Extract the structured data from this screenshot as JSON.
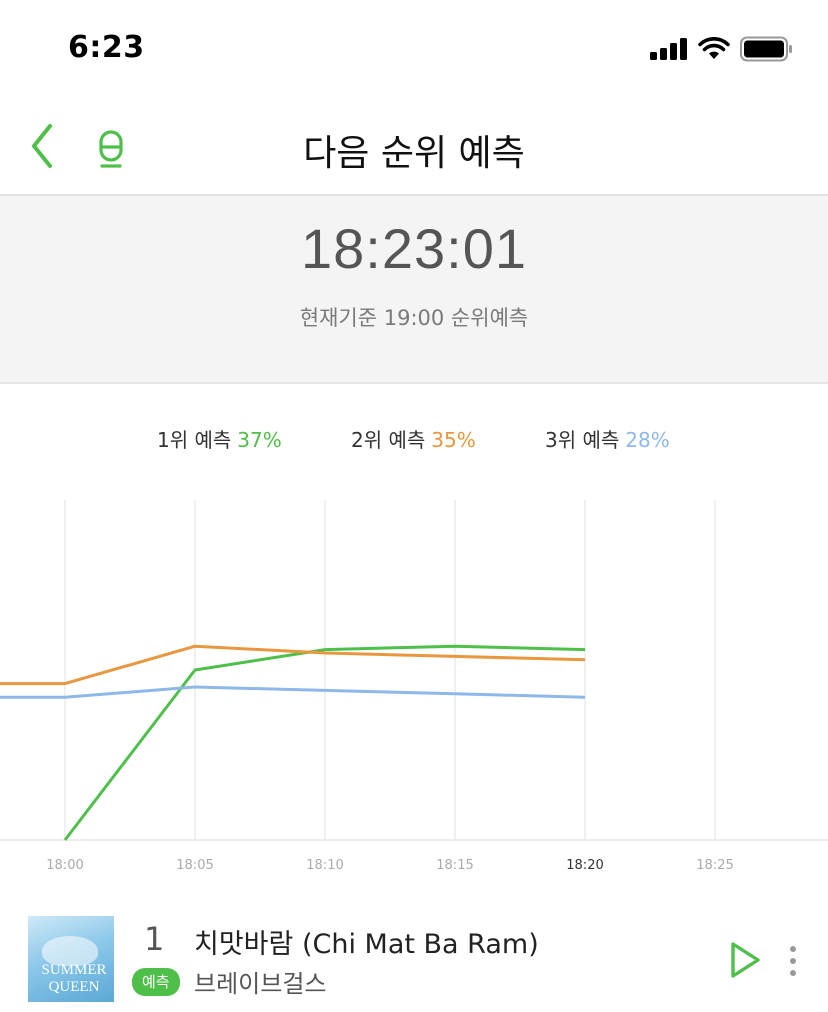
{
  "status_bar": {
    "time": "6:23"
  },
  "nav": {
    "title": "다음 순위 예측"
  },
  "clock": {
    "time": "18:23:01",
    "subtitle": "현재기준 19:00 순위예측"
  },
  "legend": [
    {
      "label": "1위 예측",
      "percent": "37%",
      "color": "#4ec04a"
    },
    {
      "label": "2위 예측",
      "percent": "35%",
      "color": "#e8973e"
    },
    {
      "label": "3위 예측",
      "percent": "28%",
      "color": "#8fb8ea"
    }
  ],
  "chart_data": {
    "type": "line",
    "x": [
      "18:00",
      "18:05",
      "18:10",
      "18:15",
      "18:20",
      "18:25"
    ],
    "ylim": [
      0,
      100
    ],
    "grid": true,
    "series": [
      {
        "name": "1위 예측",
        "color": "#4ec04a",
        "values": [
          null,
          0,
          50,
          56,
          57,
          56
        ]
      },
      {
        "name": "2위 예측",
        "color": "#e8973e",
        "values": [
          46,
          46,
          57,
          55,
          54,
          53
        ]
      },
      {
        "name": "3위 예측",
        "color": "#8fb8ea",
        "values": [
          42,
          42,
          45,
          44,
          43,
          42
        ]
      }
    ],
    "x_positions_offset": -1,
    "highlight_tick": "18:20"
  },
  "song": {
    "rank": "1",
    "title": "치맛바람 (Chi Mat Ba Ram)",
    "badge": "예측",
    "artist": "브레이브걸스",
    "album_text": [
      "SUMMER",
      "QUEEN"
    ],
    "accent": "#4ec04a"
  }
}
